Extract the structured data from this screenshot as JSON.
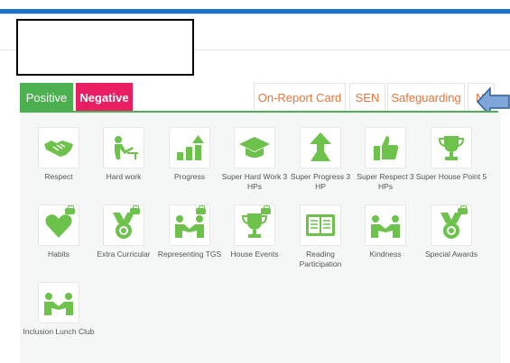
{
  "tabs": {
    "positive": "Positive",
    "negative": "Negative",
    "on_report": "On-Report Card",
    "sen": "SEN",
    "safeguarding": "Safeguarding",
    "next_partial": "N"
  },
  "colors": {
    "accent_blue": "#1a73c8",
    "positive": "#4caf50",
    "negative": "#e91e63",
    "tab_text": "#e8743b",
    "icon_green": "#6cc24a"
  },
  "awards": [
    {
      "label": "Respect",
      "icon": "handshake-icon"
    },
    {
      "label": "Hard work",
      "icon": "student-desk-icon"
    },
    {
      "label": "Progress",
      "icon": "bar-chart-arrow-icon"
    },
    {
      "label": "Super Hard Work 3 HPs",
      "icon": "graduation-cap-icon"
    },
    {
      "label": "Super Progress 3 HP",
      "icon": "up-arrow-icon"
    },
    {
      "label": "Super Respect 3 HPs",
      "icon": "thumbs-up-icon"
    },
    {
      "label": "Super House Point 5",
      "icon": "trophy-icon"
    },
    {
      "label": "Habits",
      "icon": "heart-icon"
    },
    {
      "label": "Extra Curricular",
      "icon": "medal-icon"
    },
    {
      "label": "Representing TGS",
      "icon": "handshake-people-icon"
    },
    {
      "label": "House Events",
      "icon": "trophy-icon"
    },
    {
      "label": "Reading Participation",
      "icon": "book-icon"
    },
    {
      "label": "Kindness",
      "icon": "handshake-people-icon"
    },
    {
      "label": "Special Awards",
      "icon": "medal-icon"
    },
    {
      "label": "Inclusion Lunch Club",
      "icon": "handshake-people-icon"
    }
  ]
}
